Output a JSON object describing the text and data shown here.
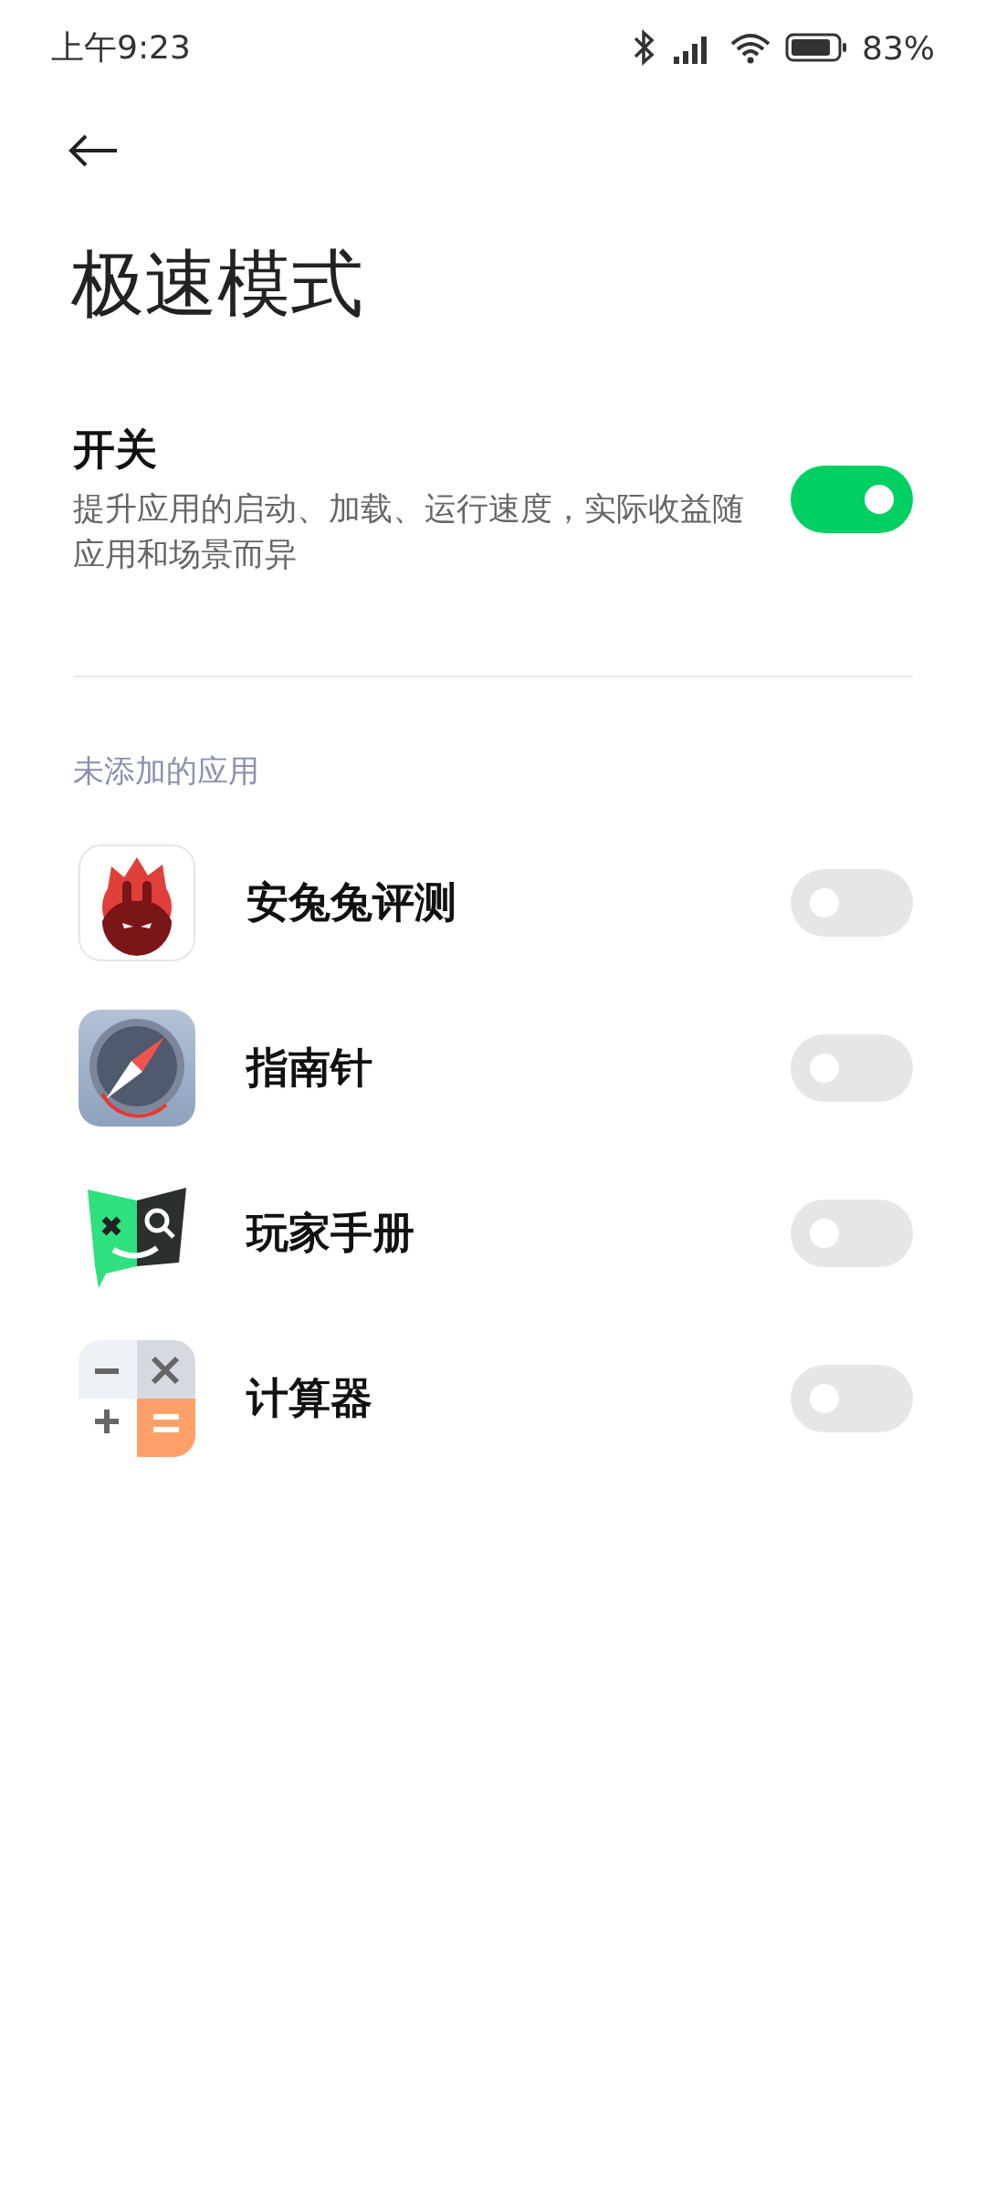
{
  "status_bar": {
    "time": "上午9:23",
    "battery_text": "83%"
  },
  "title": "极速模式",
  "master_switch": {
    "label": "开关",
    "description": "提升应用的启动、加载、运行速度，实际收益随应用和场景而异",
    "on": true
  },
  "section_header": "未添加的应用",
  "apps": [
    {
      "name": "安兔兔评测",
      "kind": "flame",
      "on": false
    },
    {
      "name": "指南针",
      "kind": "compass",
      "on": false
    },
    {
      "name": "玩家手册",
      "kind": "book",
      "on": false
    },
    {
      "name": "计算器",
      "kind": "calculator",
      "on": false
    }
  ]
}
